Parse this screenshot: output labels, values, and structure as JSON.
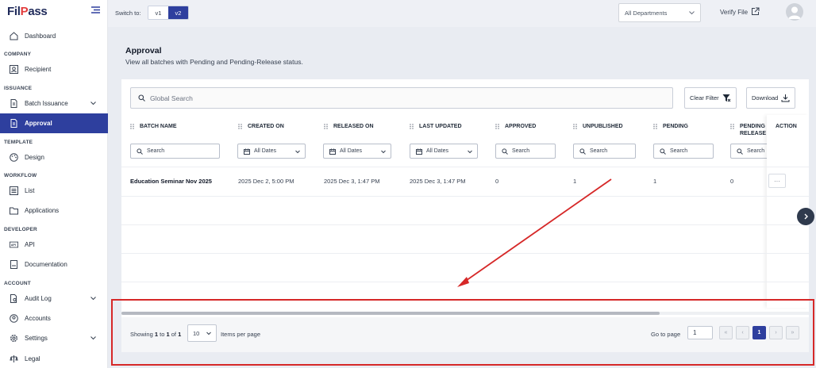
{
  "brand": {
    "logo_part1": "Fil",
    "logo_part2": "P",
    "logo_part3": "ass"
  },
  "sidebar": {
    "dashboard": "Dashboard",
    "company": "COMPANY",
    "recipient": "Recipient",
    "issuance": "ISSUANCE",
    "batch_issuance": "Batch Issuance",
    "approval": "Approval",
    "template": "TEMPLATE",
    "design": "Design",
    "workflow": "WORKFLOW",
    "list": "List",
    "applications": "Applications",
    "developer": "DEVELOPER",
    "api": "API",
    "documentation": "Documentation",
    "account": "ACCOUNT",
    "audit_log": "Audit Log",
    "accounts": "Accounts",
    "settings": "Settings",
    "legal": "Legal"
  },
  "topbar": {
    "switch_label": "Switch to:",
    "v1": "v1",
    "v2": "v2",
    "department": "All Departments",
    "verify_file": "Verify File"
  },
  "page": {
    "title": "Approval",
    "subtitle": "View all batches with Pending and Pending-Release status."
  },
  "toolbar": {
    "search_placeholder": "Global Search",
    "clear_filter": "Clear Filter",
    "download": "Download"
  },
  "table": {
    "columns": {
      "batch_name": "BATCH NAME",
      "created_on": "CREATED ON",
      "released_on": "RELEASED ON",
      "last_updated": "LAST UPDATED",
      "approved": "APPROVED",
      "unpublished": "UNPUBLISHED",
      "pending": "PENDING",
      "pending_release_1": "PENDING",
      "pending_release_2": "RELEASE",
      "action": "ACTION"
    },
    "filters": {
      "search": "Search",
      "all_dates": "All Dates"
    },
    "rows": [
      {
        "batch_name": "Education Seminar Nov 2025",
        "created_on": "2025 Dec 2, 5:00 PM",
        "released_on": "2025 Dec 3, 1:47 PM",
        "last_updated": "2025 Dec 3, 1:47 PM",
        "approved": "0",
        "unpublished": "1",
        "pending": "1",
        "pending_release": "0",
        "action": "···"
      }
    ]
  },
  "pagination": {
    "showing_prefix": "Showing",
    "from": "1",
    "to_word": "to",
    "to": "1",
    "of_word": "of",
    "total": "1",
    "per_page": "10",
    "per_page_label": "Items per page",
    "goto_label": "Go to page",
    "goto_value": "1",
    "current_page": "1",
    "first": "«",
    "prev": "‹",
    "next": "›",
    "last": "»"
  },
  "colors": {
    "primary": "#2e3f9e",
    "annotation": "#d62828"
  }
}
